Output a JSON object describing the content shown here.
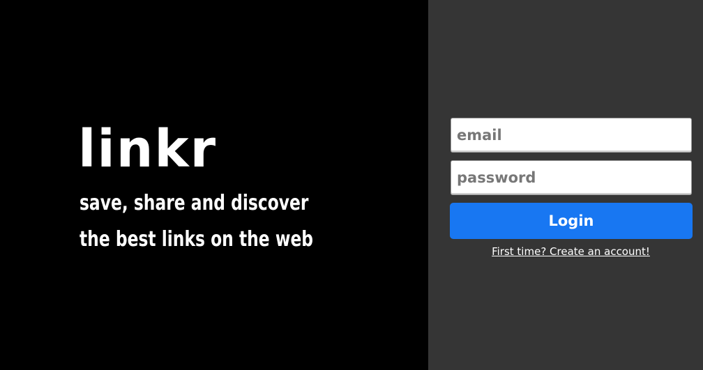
{
  "hero": {
    "brand": "linkr",
    "tagline_line1": "save, share and discover",
    "tagline_line2": "the best links on the web"
  },
  "login": {
    "email_placeholder": "email",
    "password_placeholder": "password",
    "button_label": "Login",
    "signup_link": "First time? Create an account!"
  },
  "colors": {
    "hero_background": "#000000",
    "panel_background": "#353535",
    "button_accent": "#1877f2"
  }
}
